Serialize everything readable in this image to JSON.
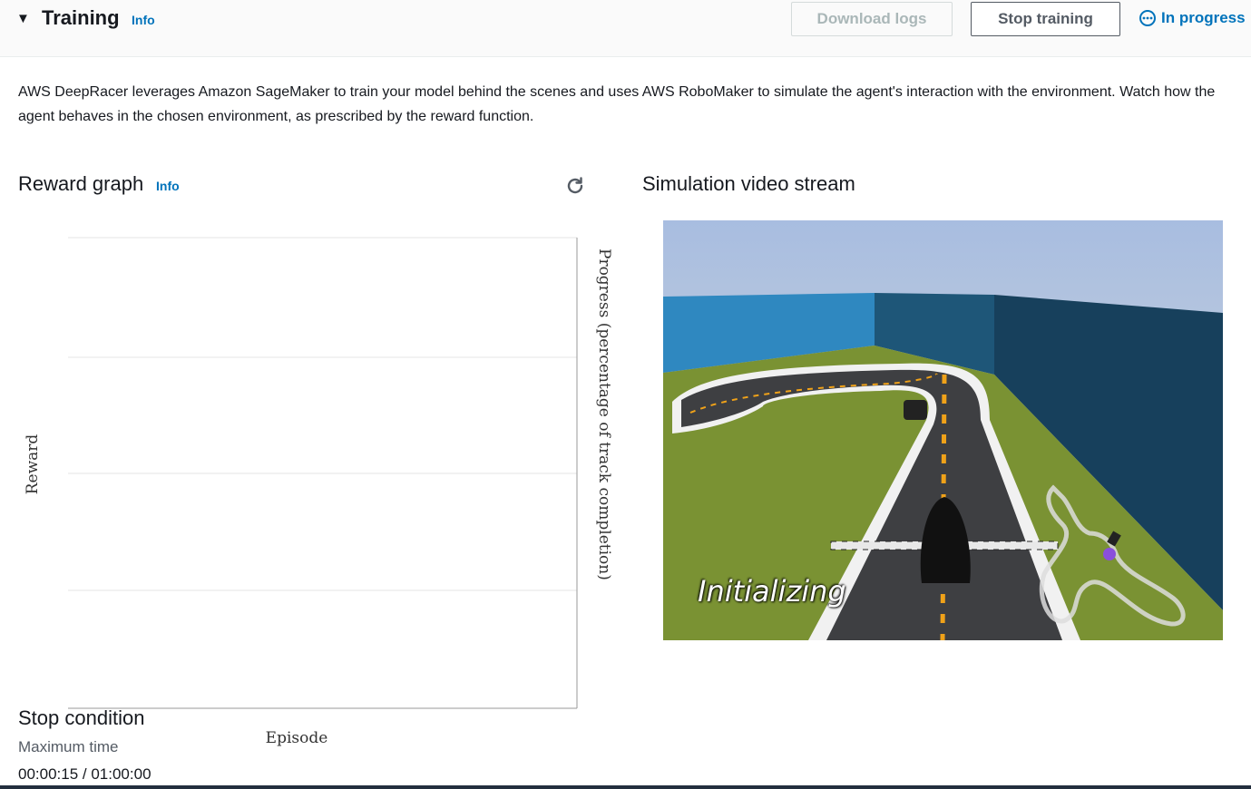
{
  "header": {
    "title": "Training",
    "info_label": "Info",
    "download_label": "Download logs",
    "stop_label": "Stop training",
    "status_label": "In progress",
    "caret_icon": "caret-down-icon",
    "status_icon": "in-progress-icon"
  },
  "description": "AWS DeepRacer leverages Amazon SageMaker to train your model behind the scenes and uses AWS RoboMaker to simulate the agent's interaction with the environment. Watch how the agent behaves in the chosen environment, as prescribed by the reward function.",
  "reward_graph": {
    "title": "Reward graph",
    "info_label": "Info",
    "refresh_icon": "refresh-icon"
  },
  "chart_data": {
    "type": "line",
    "title": "",
    "xlabel": "Episode",
    "ylabel": "Reward",
    "y2label": "Progress (percentage of track completion)",
    "series": [],
    "grid": true
  },
  "simulation": {
    "title": "Simulation video stream",
    "overlay_text": "Initializing"
  },
  "stop_condition": {
    "title": "Stop condition",
    "label": "Maximum time",
    "value": "00:00:15 / 01:00:00"
  },
  "colors": {
    "link": "#0073bb",
    "text": "#16191f",
    "border": "#545b64"
  }
}
